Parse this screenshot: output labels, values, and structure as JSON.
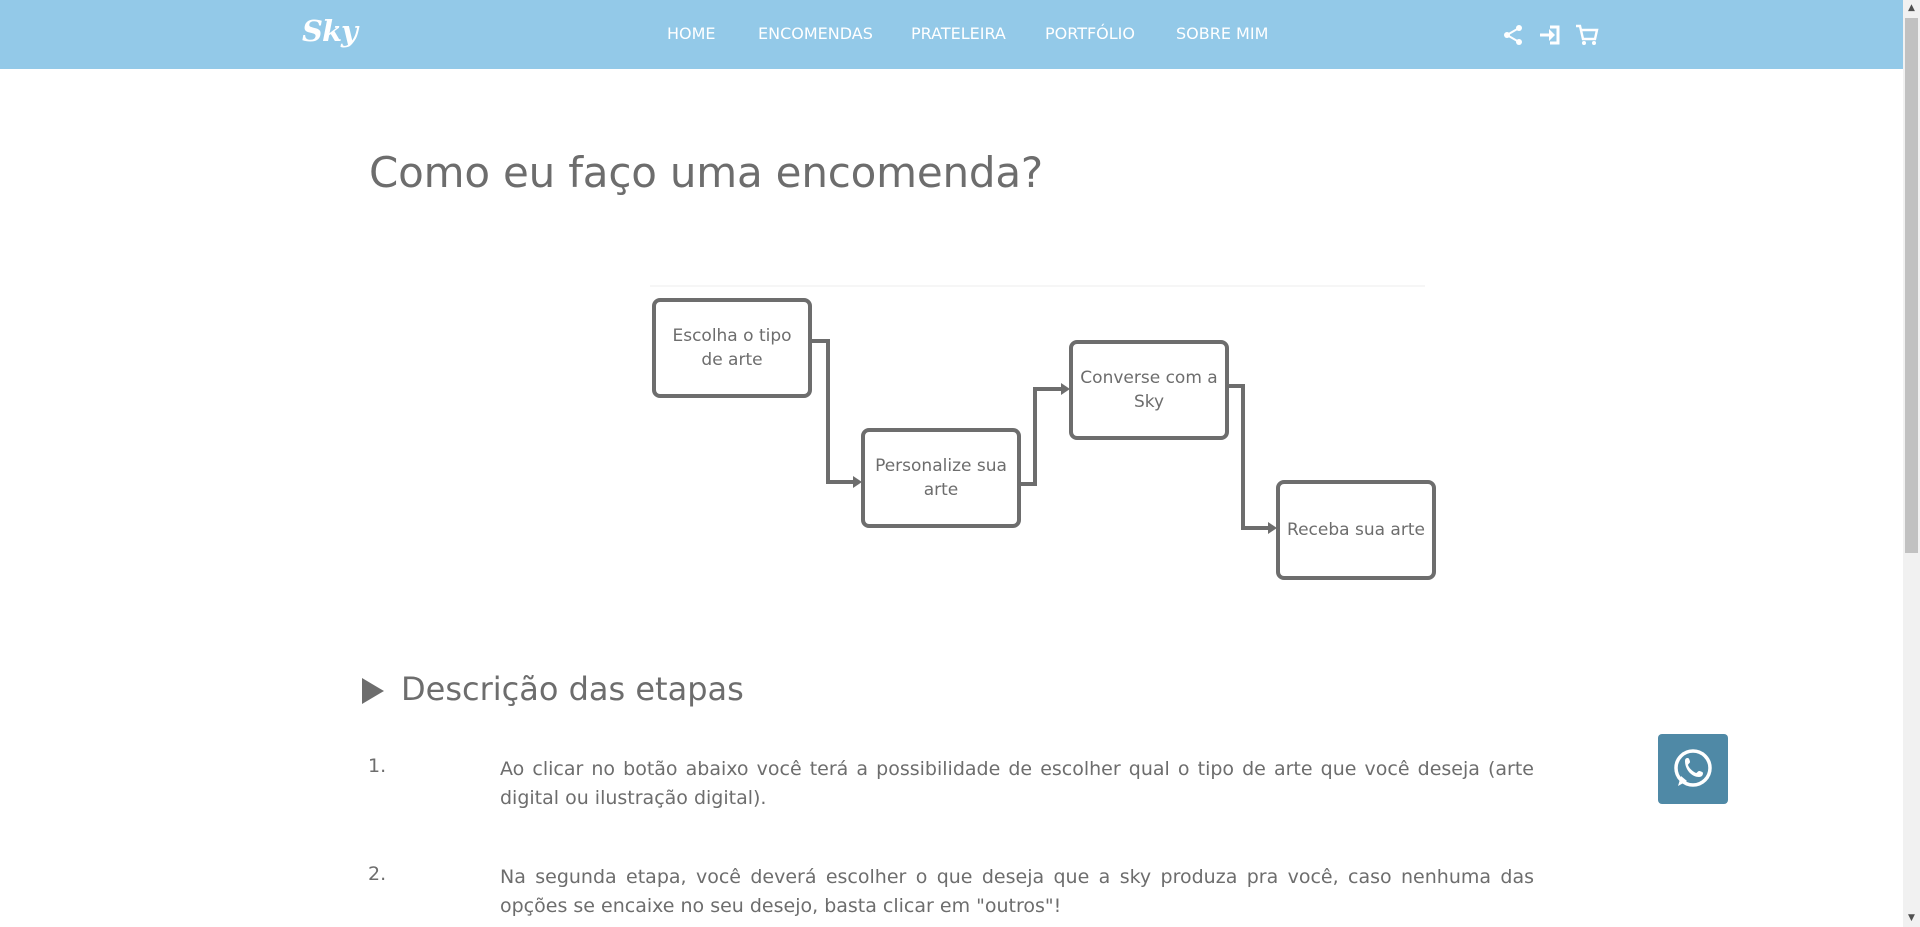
{
  "header": {
    "logo": "Sky",
    "nav": [
      "HOME",
      "ENCOMENDAS",
      "PRATELEIRA",
      "PORTFÓLIO",
      "SOBRE MIM"
    ],
    "icons": [
      "share-icon",
      "login-icon",
      "cart-icon"
    ],
    "background": "#93c9e8"
  },
  "main": {
    "title": "Como eu faço uma encomenda?",
    "flow": {
      "steps": [
        "Escolha o tipo de arte",
        "Personalize sua arte",
        "Converse com a Sky",
        "Receba sua arte"
      ]
    },
    "section_title": "Descrição das etapas",
    "steps": [
      {
        "number": "1.",
        "text": "Ao clicar no botão abaixo você terá a possibilidade de escolher qual o tipo de arte que você deseja (arte digital ou ilustração digital)."
      },
      {
        "number": "2.",
        "text": "Na segunda etapa, você deverá escolher o que deseja que a sky produza pra você, caso nenhuma das opções se encaixe no seu desejo, basta clicar em \"outros\"!"
      }
    ]
  },
  "floating": {
    "whatsapp_icon": "whatsapp-icon",
    "color": "#4f89a6"
  }
}
